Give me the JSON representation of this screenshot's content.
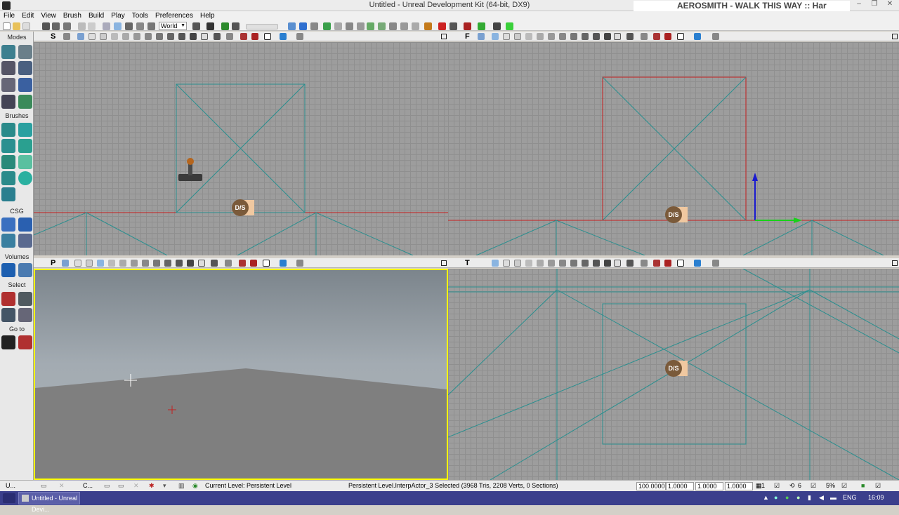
{
  "window": {
    "title": "Untitled - Unreal Development Kit (64-bit, DX9)",
    "now_playing": "AEROSMITH - WALK THIS WAY :: Har",
    "controls": [
      "–",
      "❐",
      "✕"
    ]
  },
  "menu": [
    "File",
    "Edit",
    "View",
    "Brush",
    "Build",
    "Play",
    "Tools",
    "Preferences",
    "Help"
  ],
  "toolbar": {
    "world_select": "World"
  },
  "modes": {
    "title": "Modes",
    "sections": [
      "Brushes",
      "CSG",
      "Volumes",
      "Select",
      "Go to"
    ]
  },
  "viewports": {
    "top_left_letter": "S",
    "top_right_letter": "F",
    "bottom_left_letter": "P",
    "bottom_right_letter": "T",
    "icon_text": "D/S"
  },
  "statusbar": {
    "tab1": "U...",
    "tab2": "C...",
    "current_level": "Current Level:  Persistent Level",
    "selection": "Persistent Level.InterpActor_3 Selected (3968 Tris, 2208 Verts, 0 Sections)",
    "drag_grid": "100.0000",
    "scale_x": "1.0000",
    "scale_y": "1.0000",
    "scale_z": "1.0000",
    "grid_size": "1",
    "rot_snap": "6",
    "scale_snap": "5%"
  },
  "taskbar": {
    "task_label": "Untitled - Unreal Devi...",
    "lang": "ENG",
    "time": "16:09"
  }
}
